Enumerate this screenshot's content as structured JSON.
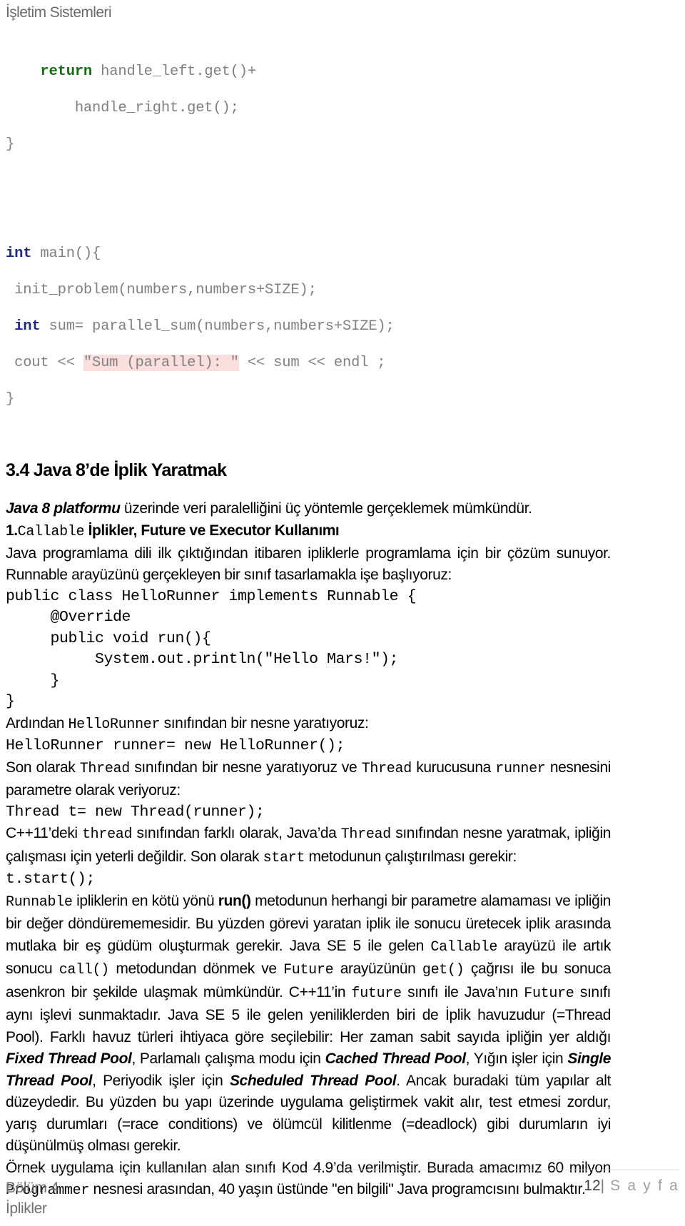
{
  "header": {
    "running_head": "İşletim Sistemleri"
  },
  "code_block_cpp": {
    "lines": [
      {
        "indent": 4,
        "parts": [
          {
            "t": "return",
            "s": "kw-green"
          },
          {
            "t": " handle_left.get()+",
            "s": ""
          }
        ]
      },
      {
        "indent": 8,
        "parts": [
          {
            "t": "handle_right.get();",
            "s": ""
          }
        ]
      },
      {
        "indent": 0,
        "parts": [
          {
            "t": "}",
            "s": ""
          }
        ]
      },
      {
        "indent": 0,
        "parts": [
          {
            "t": "",
            "s": ""
          }
        ]
      },
      {
        "indent": 0,
        "parts": [
          {
            "t": "int",
            "s": "kw-blue"
          },
          {
            "t": " main(){",
            "s": ""
          }
        ]
      },
      {
        "indent": 1,
        "parts": [
          {
            "t": "init_problem(numbers,numbers+SIZE);",
            "s": ""
          }
        ]
      },
      {
        "indent": 1,
        "parts": [
          {
            "t": "int",
            "s": "kw-blue"
          },
          {
            "t": " sum= parallel_sum(numbers,numbers+SIZE);",
            "s": ""
          }
        ]
      },
      {
        "indent": 1,
        "parts": [
          {
            "t": "cout << ",
            "s": ""
          },
          {
            "t": "\"Sum (parallel): \"",
            "s": "str-hl"
          },
          {
            "t": " << sum << endl ;",
            "s": ""
          }
        ]
      },
      {
        "indent": 0,
        "parts": [
          {
            "t": "}",
            "s": ""
          }
        ]
      }
    ],
    "colors": {
      "keyword_green": "#107010",
      "keyword_blue": "#1f2a7a",
      "body_gray": "#808080",
      "string_highlight_bg": "#fbdede"
    }
  },
  "section": {
    "number": "3.4",
    "title": "3.4 Java 8’de İplik Yaratmak",
    "intro_bold": "Java 8 platformu",
    "intro_rest": " üzerinde veri  paralelliğini üç yöntemle gerçeklemek mümkündür.",
    "list_item_1_prefix": "1.",
    "list_item_1_mono": "Callable",
    "list_item_1_rest": " İplikler, Future ve Executor Kullanımı"
  },
  "paragraphs": {
    "p1": "Java programlama dili ilk çıktığından itibaren ipliklerle programlama için bir çözüm sunuyor. Runnable arayüzünü gerçekleyen bir sınıf tasarlamakla işe başlıyoruz:",
    "after_hello_runner_1": "Ardından ",
    "after_hello_runner_mono": "HelloRunner",
    "after_hello_runner_2": " sınıfından bir nesne yaratıyoruz:",
    "thread_intro_1": "Son olarak ",
    "thread_intro_mono1": "Thread",
    "thread_intro_2": " sınıfından bir nesne yaratıyoruz ve ",
    "thread_intro_mono2": "Thread",
    "thread_intro_3": " kurucusuna ",
    "thread_intro_mono3": "runner",
    "thread_intro_4": " nesnesini parametre olarak veriyoruz:",
    "cpp_diff_1": "C++11’deki ",
    "cpp_diff_mono1": "thread",
    "cpp_diff_2": " sınıfından farklı olarak, Java’da ",
    "cpp_diff_mono2": "Thread",
    "cpp_diff_3": " sınıfından nesne yaratmak, ipliğin çalışması için yeterli değildir. Son olarak ",
    "cpp_diff_mono3": "start",
    "cpp_diff_4": " metodunun çalıştırılması gerekir:",
    "runnable_para_mono1": "Runnable",
    "runnable_para_1": " ipliklerin en kötü yönü ",
    "runnable_para_bold1": "run()",
    "runnable_para_2": " metodunun herhangi bir parametre alamaması ve ipliğin bir değer döndürememesidir. Bu yüzden görevi yaratan iplik ile sonucu üretecek iplik arasında mutlaka bir eş güdüm oluşturmak gerekir. Java SE 5 ile gelen ",
    "runnable_para_mono2": "Callable",
    "runnable_para_3": " arayüzü ile artık sonucu ",
    "runnable_para_mono3": "call()",
    "runnable_para_4": " metodundan dönmek ve ",
    "runnable_para_mono4": "Future",
    "runnable_para_5": " arayüzünün ",
    "runnable_para_mono5": "get()",
    "runnable_para_6": " çağrısı ile bu sonuca asenkron bir şekilde ulaşmak mümkündür. C++11’in ",
    "runnable_para_mono6": "future",
    "runnable_para_7": " sınıfı ile Java’nın ",
    "runnable_para_mono7": "Future",
    "runnable_para_8": " sınıfı aynı işlevi sunmaktadır. Java SE 5 ile gelen yeniliklerden biri de İplik havuzudur (=Thread Pool). Farklı havuz türleri ihtiyaca göre seçilebilir: Her zaman  sabit sayıda ipliğin yer aldığı ",
    "runnable_para_bi1": "Fixed Thread Pool",
    "runnable_para_9": ", Parlamalı çalışma modu için ",
    "runnable_para_bi2": "Cached Thread Pool",
    "runnable_para_10": ", Yığın işler için ",
    "runnable_para_bi3": "Single Thread Pool",
    "runnable_para_11": ", Periyodik işler için ",
    "runnable_para_bi4": "Scheduled Thread Pool",
    "runnable_para_12": ". Ancak buradaki tüm yapılar alt düzeydedir. Bu yüzden bu yapı üzerinde uygulama geliştirmek vakit alır, test etmesi zordur, yarış durumları (=race conditions) ve ölümcül kilitlenme (=deadlock) gibi durumların iyi düşünülmüş olması gerekir.",
    "last_1": "Örnek uygulama için kullanılan alan sınıfı Kod 4.9’da verilmiştir. Burada amacımız 60 milyon ",
    "last_mono": "Programmer",
    "last_2": " nesnesi arasından, 40 yaşın üstünde \"en bilgili\" Java programcısını bulmaktır."
  },
  "java_snippets": {
    "hello_runner_class": "public class HelloRunner implements Runnable {\n     @Override\n     public void run(){\n          System.out.println(\"Hello Mars!\");\n     }\n}",
    "runner_new": "HelloRunner runner= new HelloRunner();",
    "thread_new": "Thread t= new Thread(runner);",
    "thread_start": "t.start();"
  },
  "footer": {
    "chapter": "Bölüm 4",
    "chapter_sub": "İplikler",
    "page_number": "12",
    "separator": "|",
    "page_word": "S a y f a"
  }
}
